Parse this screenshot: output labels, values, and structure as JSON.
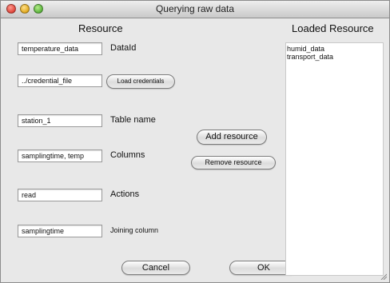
{
  "window": {
    "title": "Querying raw data"
  },
  "headings": {
    "resource": "Resource",
    "loaded": "Loaded Resource"
  },
  "rows": {
    "dataid": {
      "value": "temperature_data",
      "label": "DataId"
    },
    "credential": {
      "value": "../credential_file",
      "button": "Load credentials"
    },
    "table": {
      "value": "station_1",
      "label": "Table name"
    },
    "columns": {
      "value": "samplingtime, temp",
      "label": "Columns"
    },
    "actions": {
      "value": "read",
      "label": "Actions"
    },
    "joining": {
      "value": "samplingtime",
      "label": "Joining column"
    }
  },
  "buttons": {
    "add_resource": "Add resource",
    "remove_resource": "Remove resource",
    "cancel": "Cancel",
    "ok": "OK"
  },
  "loaded_items": [
    "humid_data",
    "transport_data"
  ]
}
